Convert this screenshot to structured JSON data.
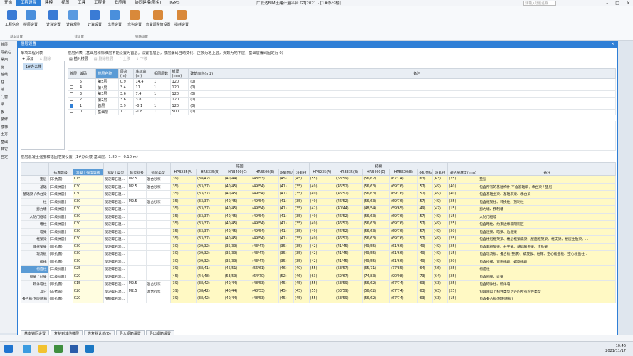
{
  "app": {
    "title": "广联达BIM土建计量平台 GTJ2021 - [1#办公楼]",
    "search_placeholder": "请输入功能名称",
    "menu": [
      "开始",
      "工程设置",
      "建模",
      "视图",
      "工具",
      "工程量",
      "云应用",
      "协同建模(限免)",
      "IGMS"
    ],
    "active_menu": "工程设置"
  },
  "ribbon": {
    "buttons": [
      "工程信息",
      "楼层设置",
      "计算设置",
      "计算规则",
      "计算设置",
      "比重设置",
      "弯钩设置",
      "弯曲调整值设置",
      "损耗设置"
    ],
    "groups": [
      "基本设置",
      "土建设置",
      "钢筋设置"
    ]
  },
  "left_panel": {
    "items": [
      "首层",
      "导航栏",
      "常用",
      "施工",
      "轴线",
      "柱",
      "墙",
      "门窗",
      "梁",
      "板",
      "装修",
      "楼梯",
      "土方",
      "基础",
      "其它",
      "自定"
    ]
  },
  "dialog": {
    "title": "楼层设置",
    "close": "×",
    "project_list_label": "单项工程列表",
    "floor_list_label": "楼层列表（基础层和标准层不能设置为首层。设置首层后，楼层编码自动变化，正数为地上层，负数为地下层，基础层编码固定为 0）",
    "proj_toolbar": [
      "添加",
      "删除"
    ],
    "floor_toolbar": [
      "插入楼层",
      "删除楼层",
      "上移",
      "下移"
    ],
    "project_name": "1#办公楼",
    "floor_headers": [
      "首层",
      "编码",
      "楼层名称",
      "层高(m)",
      "底标高(m)",
      "相同层数",
      "板厚(mm)",
      "建筑面积(m2)",
      "备注"
    ],
    "floors": [
      {
        "checked": false,
        "code": "5",
        "name": "第5层",
        "height": "0.9",
        "bottom": "14.4",
        "same": "1",
        "thick": "120",
        "area": "(0)",
        "note": ""
      },
      {
        "checked": false,
        "code": "4",
        "name": "第4层",
        "height": "3.4",
        "bottom": "11",
        "same": "1",
        "thick": "120",
        "area": "(0)",
        "note": ""
      },
      {
        "checked": false,
        "code": "3",
        "name": "第3层",
        "height": "3.6",
        "bottom": "7.4",
        "same": "1",
        "thick": "120",
        "area": "(0)",
        "note": ""
      },
      {
        "checked": false,
        "code": "2",
        "name": "第2层",
        "height": "3.6",
        "bottom": "3.8",
        "same": "1",
        "thick": "120",
        "area": "(0)",
        "note": ""
      },
      {
        "checked": true,
        "code": "1",
        "name": "首层",
        "height": "3.9",
        "bottom": "-0.1",
        "same": "1",
        "thick": "120",
        "area": "(0)",
        "note": ""
      },
      {
        "checked": false,
        "code": "0",
        "name": "基础层",
        "height": "1.7",
        "bottom": "-1.8",
        "same": "1",
        "thick": "500",
        "area": "(0)",
        "note": ""
      }
    ],
    "material_label": "楼层混凝土强度和锚固搭接设置（1#办公楼 基础层, -1.80 ~ -0.10 m）",
    "anchor_group": "锚固",
    "lap_group": "搭接",
    "mat_headers": [
      "抗震等级",
      "混凝土强度等级",
      "混凝土类型",
      "砂浆标号",
      "砂浆类型",
      "HPB235(A)",
      "HRB335(B)",
      "HRB400(C)",
      "HRB500(E)",
      "冷轧带肋",
      "冷轧扭",
      "HPB235(A)",
      "HRB335(B)",
      "HRB400(C)",
      "HRB500(E)",
      "冷轧带肋",
      "冷轧扭",
      "保护层厚度(mm)",
      "备注"
    ],
    "materials": [
      [
        "垫层",
        "(非抗震)",
        "C15",
        "现浇碎石混...",
        "M2.5",
        "混合砂浆",
        "(39)",
        "(38/42)",
        "(40/44)",
        "(48/53)",
        "(45)",
        "(45)",
        "(55)",
        "(53/59)",
        "(56/62)",
        "(67/74)",
        "(63)",
        "(63)",
        "(25)",
        "垫层"
      ],
      [
        "基础",
        "(二级抗震)",
        "C30",
        "现浇碎石混...",
        "M2.5",
        "混合砂浆",
        "(35)",
        "(33/37)",
        "(40/45)",
        "(49/54)",
        "(41)",
        "(35)",
        "(49)",
        "(46/52)",
        "(56/63)",
        "(69/76)",
        "(57)",
        "(49)",
        "(40)",
        "包含所有的基础构件,不含基础梁 / 承台梁 / 垫层"
      ],
      [
        "基础梁 / 承台梁",
        "(二级抗震)",
        "C30",
        "现浇碎石混...",
        "",
        "",
        "(35)",
        "(33/37)",
        "(40/45)",
        "(49/54)",
        "(41)",
        "(35)",
        "(49)",
        "(46/52)",
        "(56/63)",
        "(69/76)",
        "(57)",
        "(49)",
        "(40)",
        "包含基础主梁、基础次梁、承台梁"
      ],
      [
        "柱",
        "(二级抗震)",
        "C30",
        "现浇碎石混...",
        "M2.5",
        "混合砂浆",
        "(35)",
        "(33/37)",
        "(40/45)",
        "(49/54)",
        "(41)",
        "(35)",
        "(49)",
        "(46/52)",
        "(56/63)",
        "(69/76)",
        "(57)",
        "(49)",
        "(25)",
        "包含框架柱、转换柱、预制柱"
      ],
      [
        "剪力墙",
        "(二级抗震)",
        "C30",
        "现浇碎石混...",
        "",
        "",
        "(35)",
        "(33/37)",
        "(40/45)",
        "(49/54)",
        "(41)",
        "(35)",
        "(42)",
        "(40/44)",
        "(48/54)",
        "(59/65)",
        "(49)",
        "(42)",
        "(15)",
        "剪力墙、预制墙"
      ],
      [
        "人防门框墙",
        "(二级抗震)",
        "C30",
        "现浇碎石混...",
        "",
        "",
        "(35)",
        "(33/37)",
        "(40/45)",
        "(49/54)",
        "(41)",
        "(35)",
        "(49)",
        "(46/52)",
        "(56/63)",
        "(69/76)",
        "(57)",
        "(49)",
        "(15)",
        "人防门框墙"
      ],
      [
        "墙柱",
        "(二级抗震)",
        "C30",
        "现浇碎石混...",
        "",
        "",
        "(35)",
        "(33/37)",
        "(40/45)",
        "(49/54)",
        "(41)",
        "(35)",
        "(49)",
        "(46/52)",
        "(56/63)",
        "(69/76)",
        "(57)",
        "(49)",
        "(25)",
        "包含暗柱、约束边缘非阴影区"
      ],
      [
        "墙梁",
        "(二级抗震)",
        "C30",
        "现浇碎石混...",
        "",
        "",
        "(35)",
        "(33/37)",
        "(40/45)",
        "(49/54)",
        "(41)",
        "(35)",
        "(49)",
        "(46/52)",
        "(56/63)",
        "(69/76)",
        "(57)",
        "(49)",
        "(20)",
        "包含连梁、暗梁、边框梁"
      ],
      [
        "框架梁",
        "(二级抗震)",
        "C30",
        "现浇碎石混...",
        "",
        "",
        "(35)",
        "(33/37)",
        "(40/45)",
        "(49/54)",
        "(41)",
        "(35)",
        "(49)",
        "(46/52)",
        "(56/63)",
        "(69/76)",
        "(57)",
        "(49)",
        "(25)",
        "包含楼层框架梁、楼层框架扁梁、屋面框架梁、框支梁、楼层主肋梁、..."
      ],
      [
        "非框架梁",
        "(非抗震)",
        "C30",
        "现浇碎石混...",
        "",
        "",
        "(30)",
        "(29/32)",
        "(35/39)",
        "(43/47)",
        "(35)",
        "(35)",
        "(42)",
        "(41/45)",
        "(49/55)",
        "(61/66)",
        "(49)",
        "(49)",
        "(25)",
        "包含非框架梁、井字梁、基础联系梁、次肋梁"
      ],
      [
        "现浇板",
        "(非抗震)",
        "C30",
        "现浇碎石混...",
        "",
        "",
        "(30)",
        "(29/32)",
        "(35/39)",
        "(43/47)",
        "(35)",
        "(35)",
        "(42)",
        "(41/45)",
        "(49/55)",
        "(61/66)",
        "(49)",
        "(49)",
        "(15)",
        "包含现浇板、叠合板(整厚)、螺旋板、柱帽、空心楼盖板、空心楼盖柱..."
      ],
      [
        "楼梯",
        "(非抗震)",
        "C30",
        "现浇碎石混...",
        "",
        "",
        "(30)",
        "(29/32)",
        "(35/39)",
        "(43/47)",
        "(35)",
        "(35)",
        "(42)",
        "(41/45)",
        "(49/55)",
        "(61/66)",
        "(49)",
        "(49)",
        "(20)",
        "包含楼梯、直形梯段、螺旋梯段"
      ],
      [
        "构造柱",
        "(二级抗震)",
        "C25",
        "现浇碎石混...",
        "",
        "",
        "(39)",
        "(38/41)",
        "(46/51)",
        "(56/61)",
        "(46)",
        "(40)",
        "(55)",
        "(53/57)",
        "(65/71)",
        "(77/85)",
        "(64)",
        "(56)",
        "(25)",
        "构造柱"
      ],
      [
        "圈梁 / 过梁",
        "(二级抗震)",
        "C20",
        "现浇碎石混...",
        "",
        "",
        "(45)",
        "(44/48)",
        "(53/59)",
        "(64/70)",
        "(52)",
        "(46)",
        "(63)",
        "(62/67)",
        "(74/83)",
        "(90/98)",
        "(73)",
        "(64)",
        "(25)",
        "包含圈梁、过梁"
      ],
      [
        "砌体墙柱",
        "(非抗震)",
        "C15",
        "现浇碎石混...",
        "M2.5",
        "混合砂浆",
        "(39)",
        "(38/42)",
        "(40/44)",
        "(48/53)",
        "(45)",
        "(45)",
        "(55)",
        "(53/59)",
        "(56/62)",
        "(67/74)",
        "(63)",
        "(63)",
        "(25)",
        "包含砌体柱、砌体墙"
      ],
      [
        "其它",
        "(非抗震)",
        "C20",
        "现浇碎石混...",
        "M2.5",
        "混合砂浆",
        "(39)",
        "(38/42)",
        "(40/44)",
        "(48/53)",
        "(45)",
        "(45)",
        "(55)",
        "(53/59)",
        "(56/62)",
        "(67/74)",
        "(63)",
        "(63)",
        "(25)",
        "包含除以上构件类型之外的所有构件类型"
      ],
      [
        "叠合板(预制底板)",
        "(非抗震)",
        "C20",
        "预制碎石混...",
        "",
        "",
        "(39)",
        "(38/42)",
        "(40/44)",
        "(48/53)",
        "(45)",
        "(45)",
        "(55)",
        "(53/59)",
        "(56/62)",
        "(67/74)",
        "(63)",
        "(63)",
        "(15)",
        "包含叠合板(预制底板)"
      ]
    ],
    "buttons": [
      "基本锚固设置",
      "复制到其他楼层",
      "恢复默认值(D)",
      "导入钢筋设置",
      "导出钢筋设置"
    ]
  },
  "status_bar": "",
  "taskbar": {
    "time": "10:46",
    "date": "2021/11/17"
  }
}
